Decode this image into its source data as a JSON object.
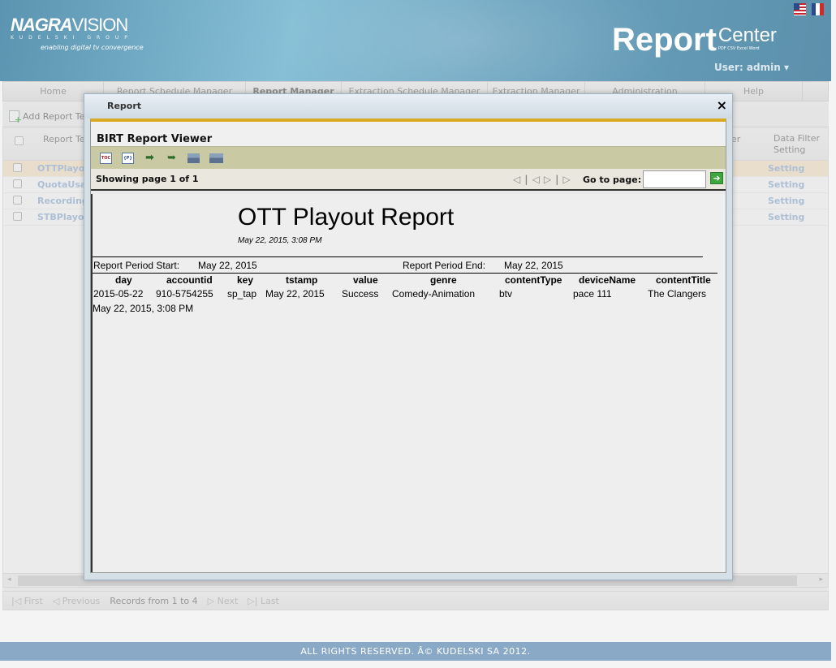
{
  "header": {
    "logo_brand_bold": "NAGRA",
    "logo_brand_thin": "VISION",
    "logo_group": "KUDELSKI GROUP",
    "logo_tagline": "enabling digital tv convergence",
    "product_big": "Report",
    "product_small": "Center",
    "product_formats": "PDF CSV Excel Word",
    "user_label": "User: admin ▾"
  },
  "nav": {
    "items": [
      "Home",
      "Report Schedule Manager",
      "Report Manager",
      "Extraction Schedule Manager",
      "Extraction Manager",
      "Administration",
      "Help"
    ]
  },
  "toolbar": {
    "add_label": "Add Report Ter"
  },
  "table": {
    "col_template": "Report Ter",
    "col_filter_partial": "er",
    "col_data_filter": "Data Filter Setting",
    "rows": [
      {
        "name": "OTTPlayou",
        "setting": "Setting"
      },
      {
        "name": "QuotaUsa",
        "setting": "Setting"
      },
      {
        "name": "Recording",
        "setting": "Setting"
      },
      {
        "name": "STBPlayou",
        "setting": "Setting"
      }
    ]
  },
  "pager": {
    "first": "First",
    "previous": "Previous",
    "records": "Records from 1 to 4",
    "next": "Next",
    "last": "Last"
  },
  "footer": {
    "text": "ALL RIGHTS RESERVED. Â© KUDELSKI SA 2012."
  },
  "modal": {
    "title": "Report",
    "close": "×",
    "viewer_title": "BIRT Report Viewer",
    "tools": [
      "TOC",
      "{P}"
    ],
    "page_label": "Showing page  1  of  1",
    "goto_label": "Go to page:",
    "goto_value": "",
    "report": {
      "title": "OTT Playout Report",
      "date": "May 22, 2015, 3:08 PM",
      "period_start_label": "Report Period Start:",
      "period_start_value": "May 22, 2015",
      "period_end_label": "Report Period End:",
      "period_end_value": "May 22, 2015",
      "columns": [
        "day",
        "accountid",
        "key",
        "tstamp",
        "value",
        "genre",
        "contentType",
        "deviceName",
        "contentTitle"
      ],
      "row": [
        "2015-05-22",
        "910-5754255",
        "sp_tap",
        "May 22, 2015",
        "Success",
        "Comedy-Animation",
        "btv",
        "pace 111",
        "The Clangers"
      ],
      "footer_date": "May 22, 2015, 3:08 PM"
    }
  }
}
